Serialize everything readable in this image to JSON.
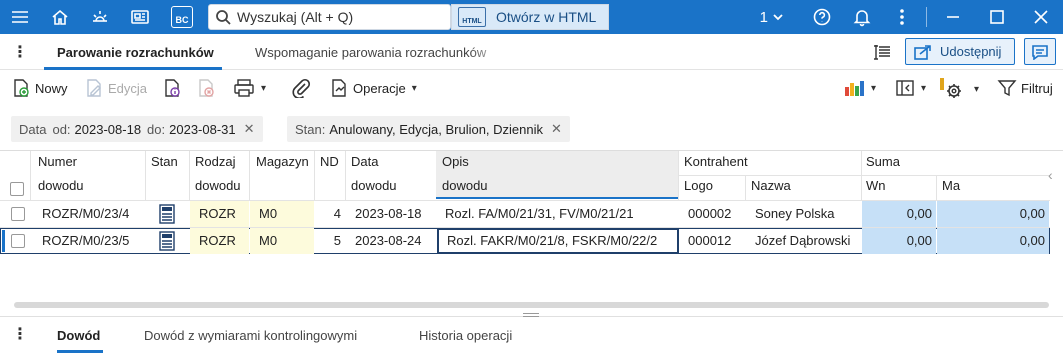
{
  "titlebar": {
    "search_placeholder": "Wyszukaj (Alt + Q)",
    "open_html_label": "Otwórz w HTML",
    "html_badge": "HTML",
    "bc_badge": "BC",
    "counter": "1"
  },
  "tabs": {
    "active": "Parowanie rozrachunków",
    "second": "Wspomaganie parowania rozrachunków",
    "share_label": "Udostępnij"
  },
  "toolbar": {
    "new": "Nowy",
    "edit": "Edycja",
    "operations": "Operacje",
    "filter": "Filtruj"
  },
  "filters": {
    "date_label": "Data",
    "from_label": "od:",
    "from_value": "2023-08-18",
    "to_label": "do:",
    "to_value": "2023-08-31",
    "status_label": "Stan:",
    "status_value": "Anulowany, Edycja, Brulion, Dziennik"
  },
  "columns": {
    "numer": "Numer",
    "dowodu": "dowodu",
    "stan": "Stan",
    "rodzaj": "Rodzaj",
    "magazyn": "Magazyn",
    "nd": "ND",
    "data": "Data",
    "opis": "Opis",
    "kontrahent": "Kontrahent",
    "logo": "Logo",
    "nazwa": "Nazwa",
    "suma": "Suma",
    "wn": "Wn",
    "ma": "Ma"
  },
  "rows": [
    {
      "numer": "ROZR/M0/23/4",
      "rodzaj": "ROZR",
      "magazyn": "M0",
      "nd": "4",
      "data": "2023-08-18",
      "opis": "Rozl. FA/M0/21/31, FV/M0/21/21",
      "logo": "000002",
      "nazwa": "Soney Polska",
      "wn": "0,00",
      "ma": "0,00"
    },
    {
      "numer": "ROZR/M0/23/5",
      "rodzaj": "ROZR",
      "magazyn": "M0",
      "nd": "5",
      "data": "2023-08-24",
      "opis": "Rozl. FAKR/M0/21/8, FSKR/M0/22/2",
      "logo": "000012",
      "nazwa": "Józef Dąbrowski",
      "wn": "0,00",
      "ma": "0,00"
    }
  ],
  "bottom_tabs": {
    "active": "Dowód",
    "second": "Dowód z wymiarami kontrolingowymi",
    "third": "Historia operacji"
  },
  "colors": {
    "accent": "#1a73c8",
    "selected_sum": "#c6e0f7",
    "editable_cell": "#fdfbdc"
  }
}
